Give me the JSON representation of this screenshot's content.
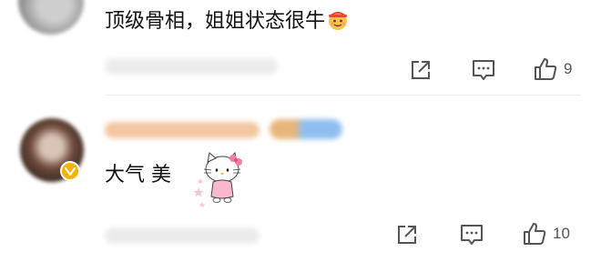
{
  "comments": [
    {
      "text": "顶级骨相，姐姐状态很牛",
      "emoji": "emoji-face-icon",
      "like_count": "9"
    },
    {
      "text": "大气 美",
      "sticker": "hello-kitty-sticker",
      "like_count": "10"
    }
  ],
  "colors": {
    "verified_badge": "#f6b300",
    "icon": "#555555"
  }
}
